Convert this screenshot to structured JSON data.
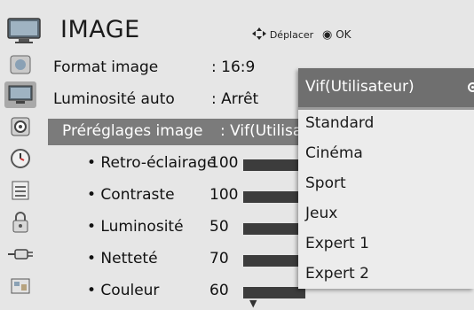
{
  "header": {
    "title": "IMAGE",
    "move_label": "Déplacer",
    "ok_label": "OK",
    "ok_symbol": "◉"
  },
  "sidebar": {
    "icons": [
      "picture-icon",
      "tv-icon",
      "audio-icon",
      "clock-icon",
      "options-icon",
      "lock-icon",
      "input-icon",
      "usb-icon"
    ],
    "active": "tv-icon"
  },
  "menu": {
    "rows": [
      {
        "label": "Format image",
        "value": ": 16:9"
      },
      {
        "label": "Luminosité auto",
        "value": ": Arrêt"
      },
      {
        "label": "Préréglages image",
        "value": ": Vif(Utilisateur)"
      }
    ],
    "sub_rows": [
      {
        "label": "• Retro-éclairage",
        "value": "100",
        "level": 100
      },
      {
        "label": "• Contraste",
        "value": "100",
        "level": 100
      },
      {
        "label": "• Luminosité",
        "value": "50",
        "level": 50
      },
      {
        "label": "• Netteté",
        "value": "70",
        "level": 70
      },
      {
        "label": "• Couleur",
        "value": "60",
        "level": 60
      }
    ],
    "more_arrow": "▼"
  },
  "dropdown": {
    "current": "Vif(Utilisateur)",
    "options": [
      "Standard",
      "Cinéma",
      "Sport",
      "Jeux",
      "Expert 1",
      "Expert 2"
    ]
  },
  "colors": {
    "background": "#e6e6e6",
    "selected_row": "#7b7b7b",
    "dropdown_current": "#6f6f6f",
    "bar": "#3c3c3c"
  }
}
